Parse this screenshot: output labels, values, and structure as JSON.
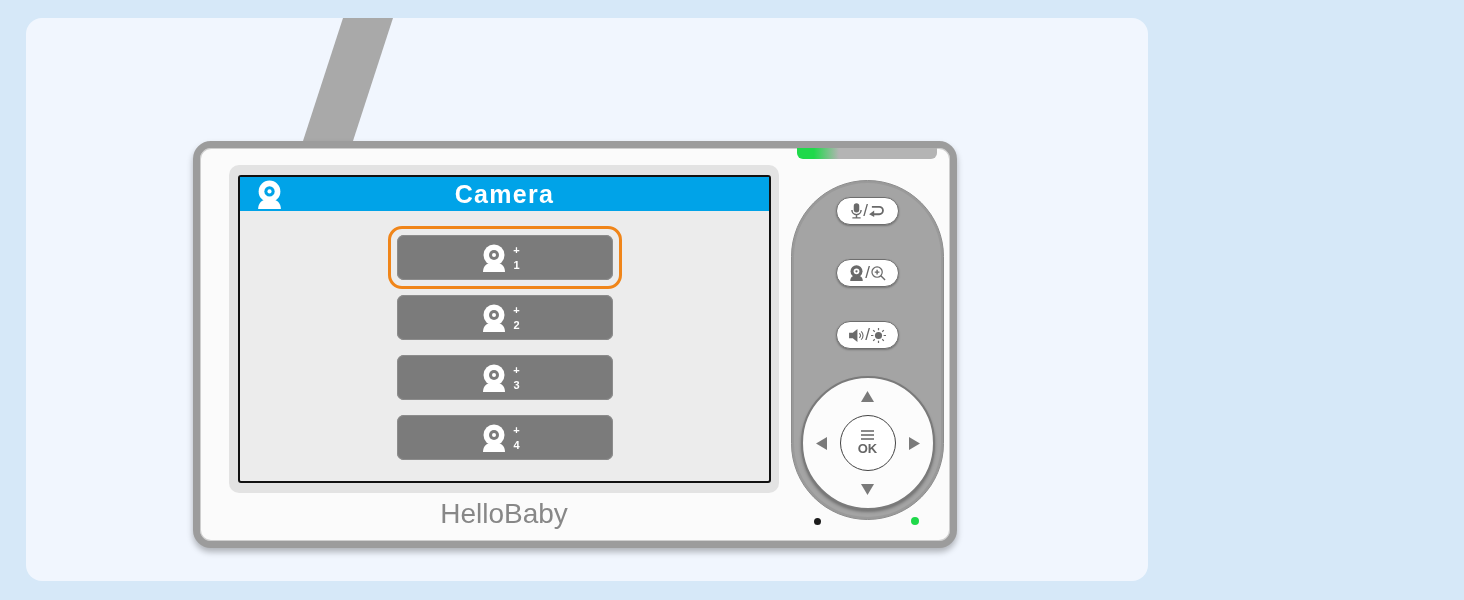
{
  "screen": {
    "title": "Camera",
    "cameras": [
      {
        "plus": "+",
        "number": "1",
        "selected": true
      },
      {
        "plus": "+",
        "number": "2",
        "selected": false
      },
      {
        "plus": "+",
        "number": "3",
        "selected": false
      },
      {
        "plus": "+",
        "number": "4",
        "selected": false
      }
    ]
  },
  "device": {
    "brand": "HelloBaby",
    "power_led": {
      "on": true
    }
  },
  "keys": [
    {
      "kind": "talk",
      "separator": "/"
    },
    {
      "kind": "zoom",
      "separator": "/"
    },
    {
      "kind": "volume",
      "separator": "/"
    }
  ],
  "dpad": {
    "ok_label": "OK"
  }
}
